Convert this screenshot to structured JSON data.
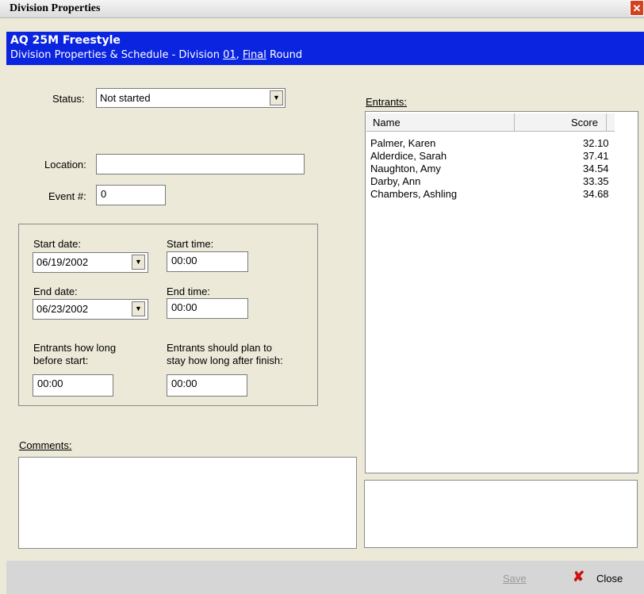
{
  "window": {
    "title": "Division Properties"
  },
  "header": {
    "event_name": "AQ 25M Freestyle",
    "subtitle_prefix": "Division Properties & Schedule - Division ",
    "division": "01",
    "sep": ", ",
    "round": "Final",
    "round_suffix": " Round"
  },
  "form": {
    "status_label": "Status:",
    "status_value": "Not started",
    "location_label": "Location:",
    "location_value": "",
    "event_label": "Event #:",
    "event_value": "0"
  },
  "schedule": {
    "start_date_label": "Start date:",
    "start_date": "06/19/2002",
    "start_time_label": "Start time:",
    "start_time": "00:00",
    "end_date_label": "End date:",
    "end_date": "06/23/2002",
    "end_time_label": "End time:",
    "end_time": "00:00",
    "before_label_1": "Entrants how long",
    "before_label_2": "before start:",
    "before_value": "00:00",
    "after_label_1": "Entrants should plan to",
    "after_label_2": "stay how long after finish:",
    "after_value": "00:00"
  },
  "comments": {
    "label": "Comments:",
    "value": ""
  },
  "entrants": {
    "label": "Entrants:",
    "col_name": "Name",
    "col_score": "Score",
    "rows": [
      {
        "name": "Palmer, Karen",
        "score": "32.10"
      },
      {
        "name": "Alderdice, Sarah",
        "score": "37.41"
      },
      {
        "name": "Naughton, Amy",
        "score": "34.54"
      },
      {
        "name": "Darby, Ann",
        "score": "33.35"
      },
      {
        "name": "Chambers, Ashling",
        "score": "34.68"
      }
    ]
  },
  "footer": {
    "save_label": "Save",
    "close_label": "Close"
  },
  "colors": {
    "header_bg": "#0a24e0",
    "close_icon": "#cc1111"
  }
}
